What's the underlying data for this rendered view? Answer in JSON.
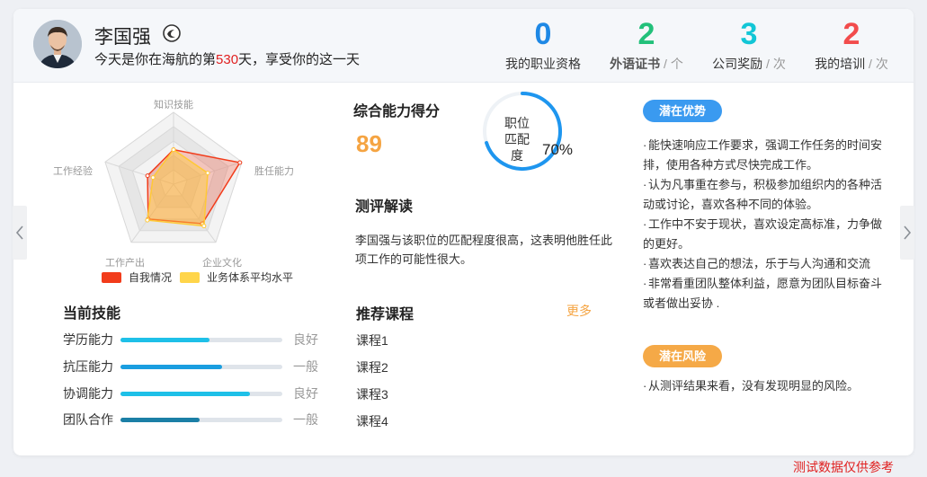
{
  "header": {
    "user_name": "李国强",
    "welcome_prefix": "今天是你在海航的第",
    "welcome_days": "530",
    "welcome_suffix": "天，享受你的这一天",
    "stats": [
      {
        "value": "0",
        "label": "我的职业资格",
        "unit": "",
        "color": "#1e88e5"
      },
      {
        "value": "2",
        "label": "外语证书",
        "unit": "个",
        "color": "#22c07a"
      },
      {
        "value": "3",
        "label": "公司奖励",
        "unit": "次",
        "color": "#12c6d6"
      },
      {
        "value": "2",
        "label": "我的培训",
        "unit": "次",
        "color": "#f24c4c"
      }
    ]
  },
  "chart_data": {
    "type": "radar",
    "axes": [
      "知识技能",
      "胜任能力",
      "企业文化",
      "工作产出",
      "工作经验"
    ],
    "series": [
      {
        "name": "自我情况",
        "values": [
          0.48,
          0.97,
          0.68,
          0.6,
          0.38
        ]
      },
      {
        "name": "业务体系平均水平",
        "values": [
          0.48,
          0.5,
          0.72,
          0.62,
          0.3
        ]
      }
    ],
    "max": 1.0,
    "colors": {
      "self": "#f23c1b",
      "average": "#ffc935"
    },
    "legend": "bottom"
  },
  "score": {
    "title": "综合能力得分",
    "value": "89"
  },
  "match": {
    "label": "职位匹配度",
    "value": "70%",
    "fraction": 0.7
  },
  "interpretation": {
    "title": "测评解读",
    "text": "李国强与该职位的匹配程度很高，这表明他胜任此项工作的可能性很大。"
  },
  "skills": {
    "title": "当前技能",
    "items": [
      {
        "name": "学历能力",
        "level": "良好",
        "fraction": 0.55,
        "color": "#1ec0e8"
      },
      {
        "name": "抗压能力",
        "level": "一般",
        "fraction": 0.63,
        "color": "#1a9ee0"
      },
      {
        "name": "协调能力",
        "level": "良好",
        "fraction": 0.8,
        "color": "#1ec0e8"
      },
      {
        "name": "团队合作",
        "level": "一般",
        "fraction": 0.49,
        "color": "#1b7fa6"
      }
    ]
  },
  "courses": {
    "title": "推荐课程",
    "more": "更多",
    "items": [
      "课程1",
      "课程2",
      "课程3",
      "课程4"
    ]
  },
  "advantages": {
    "title": "潜在优势",
    "items": [
      "能快速响应工作要求，强调工作任务的时间安排，使用各种方式尽快完成工作。",
      "认为凡事重在参与，积极参加组织内的各种活动或讨论，喜欢各种不同的体验。",
      "工作中不安于现状，喜欢设定高标准，力争做的更好。",
      "喜欢表达自己的想法，乐于与人沟通和交流",
      "非常看重团队整体利益，愿意为团队目标奋斗或者做出妥协 ."
    ]
  },
  "risks": {
    "title": "潜在风险",
    "items": [
      "从测评结果来看，没有发现明显的风险。"
    ]
  },
  "footer_note": "测试数据仅供参考"
}
